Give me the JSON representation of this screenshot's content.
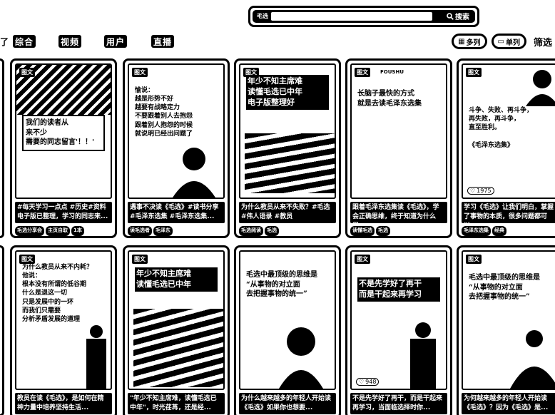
{
  "search": {
    "tag": "毛选",
    "value": "",
    "button_label": "搜索"
  },
  "tabs": {
    "lead": "了",
    "items": [
      {
        "label": "综合"
      },
      {
        "label": "视频"
      },
      {
        "label": "用户"
      },
      {
        "label": "直播"
      }
    ]
  },
  "controls": {
    "multi_label": "多列",
    "single_label": "单列",
    "filter_label": "筛选"
  },
  "cards": [
    {
      "badge": "图文",
      "head": "",
      "text": "我们的读者从\n来不少\n需要的同志留言'！！'",
      "caption": "#每天学习一点点 #历史#资料 电子版已整理，学习的同志来...",
      "tags": [
        "毛选分享会",
        "主页自取",
        "1本"
      ],
      "likes": ""
    },
    {
      "badge": "图文",
      "head": "",
      "text": "愉说：\n越是形势不好\n越要有战略定力\n不要跟着别人去抱怨\n跟着别人抱怨的时候\n就说明已经出问题了",
      "caption": "遇事不决读《毛选》#读书分享 #毛泽东选集 #毛泽东选集...",
      "tags": [
        "读毛选者",
        "毛泽东"
      ],
      "likes": ""
    },
    {
      "badge": "图文",
      "head": "",
      "text": "年少不知主席难\n读懂毛选已中年\n电子版整理好",
      "caption": "为什么教员从来不失败？#毛选 #伟人语录 #教员",
      "tags": [
        "毛选阅读",
        "毛选"
      ],
      "likes": ""
    },
    {
      "badge": "图文",
      "head": "FOUSHU",
      "text": "长脑子最快的方式\n就是去读毛泽东选集",
      "caption": "跟着毛泽东选集读《毛选》，学会正确思维，终于知道为什么很...",
      "tags": [
        "读懂毛选",
        "毛选"
      ],
      "likes": ""
    },
    {
      "badge": "图文",
      "head": "",
      "text": "斗争、失败、再斗争，\n再失败，再斗争，\n直至胜利。\n\n《毛泽东选集》",
      "caption": "学习《毛选》让我们明白，掌握了事物的本质，很多问题都可以...",
      "tags": [
        "毛泽东选集",
        "经典"
      ],
      "likes": "1975"
    },
    {
      "badge": "图文",
      "head": "",
      "text": "为什么教员从来不内耗？\n他说：\n根本没有所谓的低谷期\n什么是退这一切\n只是发展中的一环\n而我们只需要\n分析矛盾发展的道理",
      "caption": "教员在读《毛选》，是如何在精神力量中培养坚持生活...",
      "tags": [],
      "likes": ""
    },
    {
      "badge": "图文",
      "head": "",
      "text": "年少不知主席难\n读懂毛选已中年",
      "caption": "\"年少不知主席难，读懂毛选已中年\"，时光荏苒，还是经...",
      "tags": [],
      "likes": ""
    },
    {
      "badge": "",
      "head": "",
      "text": "毛选中最顶级的思维是\n“从事物的对立面\n去把握事物的统一”",
      "caption": "为什么越来越多的年轻人开始读《毛选》如果你也想要...",
      "tags": [],
      "likes": ""
    },
    {
      "badge": "图文",
      "head": "",
      "text": "不是先学好了再干\n而是干起来再学习",
      "caption": "不是先学好了再干，而是干起来再学习，当面临选择时你...",
      "tags": [],
      "likes": "948"
    },
    {
      "badge": "图文",
      "head": "",
      "text": "毛选中最顶级的思维是\n“从事物的对立面\n去把握事物的统一”",
      "caption": "为何越来越多的年轻人开始读《毛选》？因为《毛选》是...",
      "tags": [],
      "likes": ""
    }
  ]
}
